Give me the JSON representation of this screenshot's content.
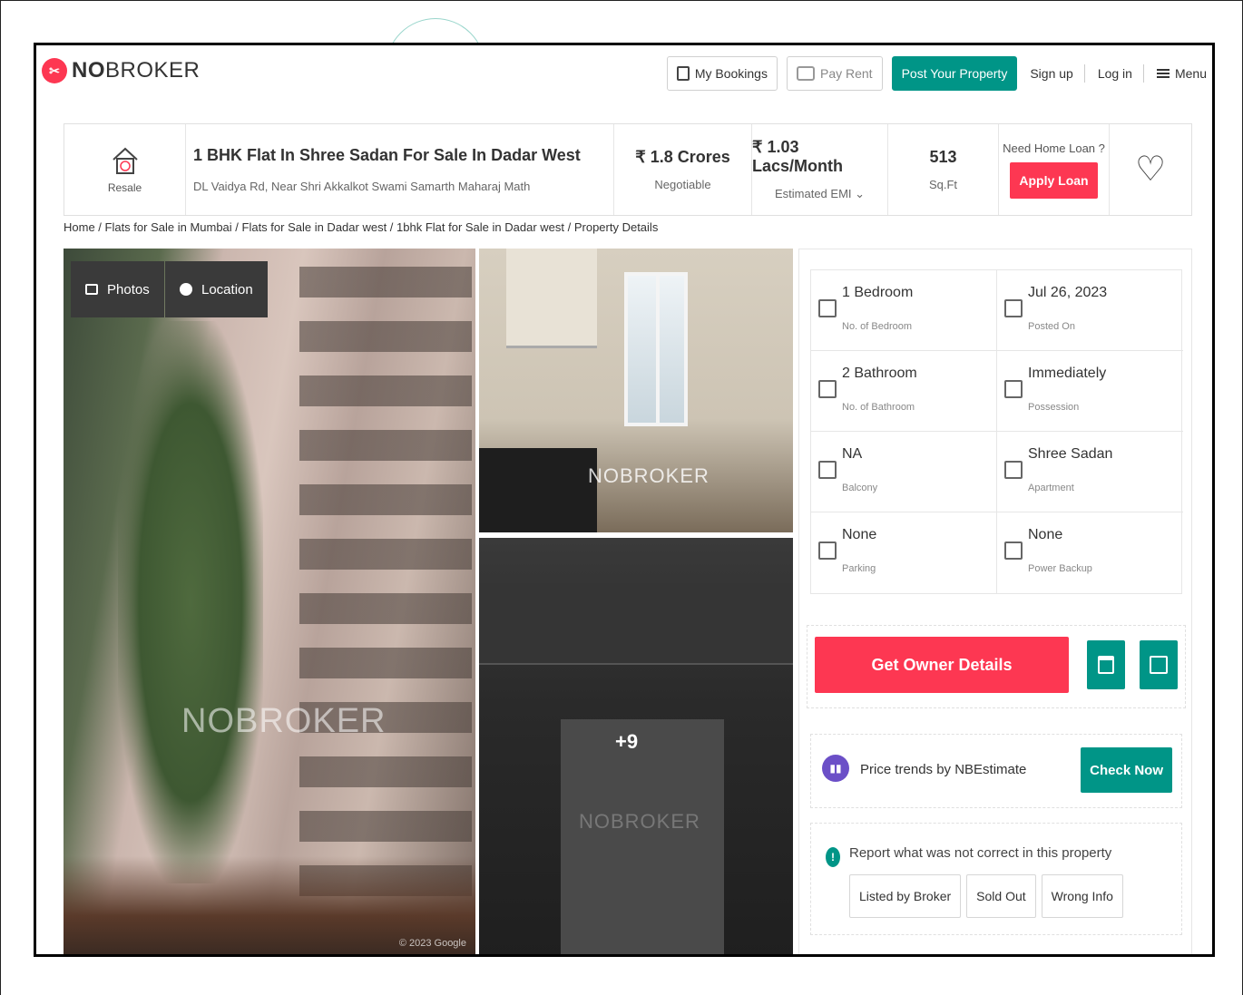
{
  "header": {
    "logo_bold": "NO",
    "logo_rest": "BROKER",
    "nav": {
      "my_bookings": "My Bookings",
      "pay_rent": "Pay Rent",
      "post_property": "Post Your Property",
      "sign_up": "Sign up",
      "log_in": "Log in",
      "menu": "Menu"
    }
  },
  "summary": {
    "type_label": "Resale",
    "title": "1 BHK Flat In Shree Sadan For Sale In Dadar West",
    "address": "DL Vaidya Rd, Near Shri Akkalkot Swami Samarth Maharaj Math",
    "price": "₹ 1.8 Crores",
    "price_note": "Negotiable",
    "emi": "₹ 1.03 Lacs/Month",
    "emi_note": "Estimated EMI ⌄",
    "area": "513",
    "area_unit": "Sq.Ft",
    "loan_question": "Need Home Loan ?",
    "apply_loan": "Apply Loan",
    "favorite_glyph": "♡"
  },
  "breadcrumb": "Home / Flats for Sale in Mumbai / Flats for Sale in Dadar west / 1bhk Flat for Sale in Dadar west / Property Details",
  "gallery": {
    "photos_label": "Photos",
    "location_label": "Location",
    "watermark": "NOBROKER",
    "copyright": "© 2023 Google",
    "more_count": "+9"
  },
  "details": [
    {
      "value": "1 Bedroom",
      "label": "No. of Bedroom",
      "icon": "bed-icon"
    },
    {
      "value": "Jul 26, 2023",
      "label": "Posted On",
      "icon": "calendar-icon"
    },
    {
      "value": "2 Bathroom",
      "label": "No. of Bathroom",
      "icon": "bath-icon"
    },
    {
      "value": "Immediately",
      "label": "Possession",
      "icon": "key-icon"
    },
    {
      "value": "NA",
      "label": "Balcony",
      "icon": "balcony-icon"
    },
    {
      "value": "Shree Sadan",
      "label": "Apartment",
      "icon": "building-icon"
    },
    {
      "value": "None",
      "label": "Parking",
      "icon": "car-icon"
    },
    {
      "value": "None",
      "label": "Power Backup",
      "icon": "battery-icon"
    }
  ],
  "actions": {
    "get_owner": "Get Owner Details",
    "trend_text": "Price trends by NBEstimate",
    "check_now": "Check Now",
    "report_text": "Report what was not correct in this property",
    "report_tags": [
      "Listed by Broker",
      "Sold Out",
      "Wrong Info"
    ]
  },
  "colors": {
    "brand_red": "#fd3752",
    "brand_teal": "#009587"
  }
}
